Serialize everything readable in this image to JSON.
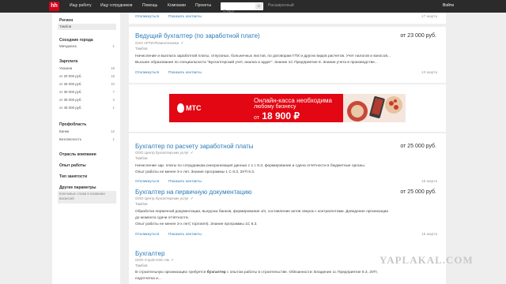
{
  "header": {
    "logo": "hh",
    "nav": [
      "Ищу работу",
      "Ищу сотрудников",
      "Помощь",
      "Компании",
      "Проекты"
    ],
    "search": {
      "placeholder": "Я ищу",
      "button": "⌕"
    },
    "advanced_search": "Расширенный",
    "login": "Войти"
  },
  "sidebar": {
    "region": {
      "title": "Регион",
      "items": [
        {
          "label": "Тамбов"
        }
      ]
    },
    "nearby": {
      "title": "Соседние города",
      "items": [
        {
          "label": "Мичуринск",
          "count": "1"
        }
      ]
    },
    "salary": {
      "title": "Зарплата",
      "items": [
        {
          "label": "Указана",
          "count": "18"
        },
        {
          "label": "от 20 000 руб.",
          "count": "18"
        },
        {
          "label": "от 25 000 руб.",
          "count": "10"
        },
        {
          "label": "от 30 000 руб.",
          "count": "7"
        },
        {
          "label": "от 35 000 руб.",
          "count": "4"
        },
        {
          "label": "от 45 000 руб.",
          "count": "1"
        }
      ]
    },
    "profarea": {
      "title": "Профобласть",
      "items": [
        {
          "label": "Банки",
          "count": "12"
        },
        {
          "label": "Безопасность",
          "count": "1"
        }
      ]
    },
    "industry": {
      "title": "Отрасль компании"
    },
    "experience": {
      "title": "Опыт работы"
    },
    "employment": {
      "title": "Тип занятости"
    },
    "other": {
      "title": "Другие параметры",
      "hint": "Ключевые слова в названии вакансий"
    }
  },
  "vacancies": [
    {
      "links": {
        "hide": "Откликнуться",
        "contacts": "Показать контакты"
      },
      "date": "17 марта"
    },
    {
      "title": "Ведущий бухгалтер (по заработной плате)",
      "salary": "от 23 000 руб.",
      "company": "ОАО АРТИ-Резинотехника",
      "city": "Тамбов",
      "lines": [
        "Начисление и выплата заработной платы, отпускных, больничных листов, по договорам ГПХ и других видов расчетов. Учет налогов и взносов...",
        "Высшее образование по специальности \"Бухгалтерский учет, анализ и аудит\". Знание 1С Предприятие 8. Знание учета в производстве..."
      ],
      "links": {
        "hide": "Откликнуться",
        "contacts": "Показать контакты"
      },
      "date": "13 марта"
    },
    {
      "title": "Бухгалтер по расчету заработной платы",
      "salary": "от 25 000 руб.",
      "company": "ООО Центр бухгалтерских услуг",
      "city": "Тамбов",
      "lines": [
        "Начисление зар. платы по сотрудникам,синхронизация данных с 1 с 8.3, формирование и сдача отчётности в бюджетные органы.",
        "Опыт работы не менее 3-х лет. Знание программы 1 С 8.3, ЗУП 8.3."
      ],
      "links": {
        "hide": "Откликнуться",
        "contacts": "Показать контакты"
      },
      "date": "15 марта"
    },
    {
      "title": "Бухгалтер на первичную документацию",
      "salary": "от 25 000 руб.",
      "company": "ООО Центр бухгалтерских услуг",
      "city": "Тамбов",
      "lines": [
        "Обработка первичной документации, выгрузка банков, формирование з/п, составление актов сверок с контрагентами. Доведение организации",
        "до момента сдачи отчётности.",
        "Опыт работы не менее 3-х лет( торговля). Знание программы 1С 8.3."
      ],
      "links": {
        "hide": "Откликнуться",
        "contacts": "Показать контакты"
      },
      "date": "15 марта"
    },
    {
      "title": "Бухгалтер",
      "company": "ООО Строй НЭС-АБ",
      "city": "Тамбов",
      "line_pre": "В строительную организацию требуется ",
      "line_bold": "бухгалтер",
      "line_post": " с опытом работы в строительстве. Обязанности: Владение 1с Предприятие 8.3, ЗУП,",
      "lines": [
        "подотчетка и..."
      ]
    }
  ],
  "banner": {
    "brand": "МТС",
    "line1": "Онлайн-касса необходима",
    "line2": "любому бизнесу",
    "from": "от",
    "price": "18 900 ₽"
  },
  "watermark": "YAPLAKAL.COM",
  "colors": {
    "accent": "#2a7ab8",
    "brand": "#d6001c",
    "banner": "#e30613",
    "verified": "#3d9be0"
  }
}
